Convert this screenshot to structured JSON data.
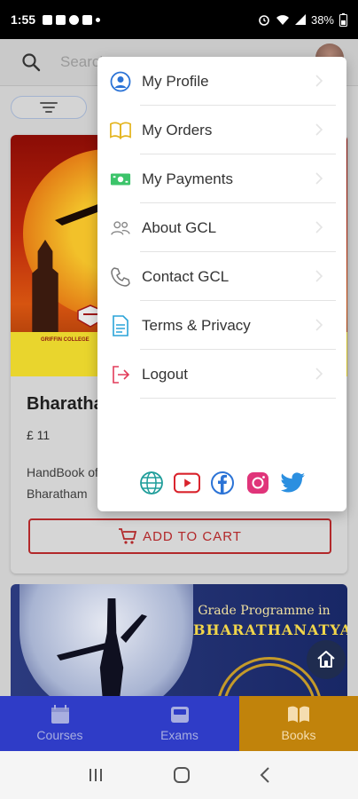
{
  "status_bar": {
    "time": "1:55",
    "battery": "38%"
  },
  "search": {
    "placeholder": "Search"
  },
  "card": {
    "banner_text": "GRIFFIN COLLEGE",
    "title": "Bharathanatyam",
    "price": "£ 11",
    "description_line1": "HandBook of",
    "description_line2": "Bharatham",
    "cart_label": "ADD TO CART"
  },
  "card2": {
    "title_line1": "Grade Programme in",
    "title_line2": "BHARATHANATYAM"
  },
  "menu": {
    "items": [
      {
        "label": "My Profile",
        "icon": "profile-icon"
      },
      {
        "label": "My Orders",
        "icon": "book-icon"
      },
      {
        "label": "My Payments",
        "icon": "payment-icon"
      },
      {
        "label": "About GCL",
        "icon": "group-icon"
      },
      {
        "label": "Contact GCL",
        "icon": "phone-icon"
      },
      {
        "label": "Terms & Privacy",
        "icon": "document-icon"
      },
      {
        "label": "Logout",
        "icon": "logout-icon"
      }
    ],
    "social": [
      "globe-icon",
      "youtube-icon",
      "facebook-icon",
      "instagram-icon",
      "twitter-icon"
    ]
  },
  "bottom_nav": {
    "items": [
      {
        "label": "Courses",
        "icon": "calendar-icon"
      },
      {
        "label": "Exams",
        "icon": "inbox-icon"
      },
      {
        "label": "Books",
        "icon": "open-book-icon"
      }
    ],
    "active": "Books"
  },
  "colors": {
    "accent_nav": "#2f3cc7",
    "active_nav": "#c1830b",
    "cart_red": "#b2282a"
  }
}
